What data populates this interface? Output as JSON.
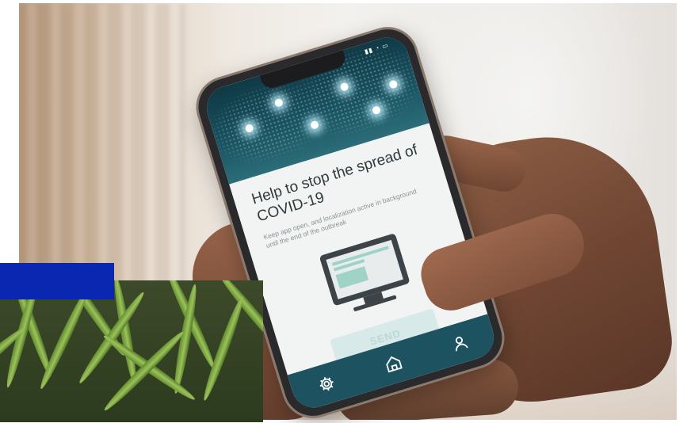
{
  "phone_app": {
    "title": "Help to stop the spread of COVID-19",
    "subtitle": "Keep app open, and localization active in background until the end of the outbreak",
    "send_label": "SEND",
    "nav": [
      "gear-icon",
      "home-icon",
      "user-icon"
    ],
    "colors": {
      "header": "#1b5563",
      "navbar": "#1d5261",
      "accent": "#9fd3c6",
      "send_button": "#d7e9e9"
    }
  },
  "overlay": {
    "blue_bar_color": "#0a27b2"
  }
}
